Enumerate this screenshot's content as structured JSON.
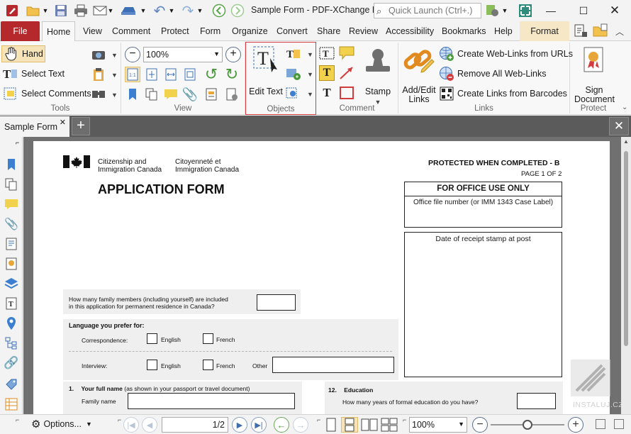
{
  "window": {
    "title": "Sample Form - PDF-XChange E...",
    "quick_launch_placeholder": "Quick Launch (Ctrl+.)"
  },
  "ribbon_tabs": [
    "File",
    "Home",
    "View",
    "Comment",
    "Protect",
    "Form",
    "Organize",
    "Convert",
    "Share",
    "Review",
    "Accessibility",
    "Bookmarks",
    "Help",
    "Format"
  ],
  "ribbon": {
    "tools": {
      "label": "Tools",
      "hand": "Hand",
      "select_text": "Select Text",
      "select_comments": "Select Comments"
    },
    "view": {
      "label": "View",
      "zoom": "100%"
    },
    "objects": {
      "label": "Objects",
      "edit_text": "Edit Text"
    },
    "comment": {
      "label": "Comment",
      "stamp": "Stamp"
    },
    "links": {
      "label": "Links",
      "add_edit": "Add/Edit Links",
      "create_web_links": "Create Web-Links from URLs",
      "remove_web_links": "Remove All Web-Links",
      "create_barcode_links": "Create Links from Barcodes"
    },
    "protect": {
      "label": "Protect",
      "sign_document": "Sign Document"
    }
  },
  "document_tab": {
    "name": "Sample Form"
  },
  "form": {
    "dept_en": [
      "Citizenship and",
      "Immigration Canada"
    ],
    "dept_fr": [
      "Citoyenneté et",
      "Immigration Canada"
    ],
    "protected": "PROTECTED WHEN COMPLETED - B",
    "page_of": "PAGE 1 OF 2",
    "title": "APPLICATION FORM",
    "office_use": "FOR OFFICE USE ONLY",
    "office_file": "Office file number (or IMM 1343 Case Label)",
    "receipt_stamp": "Date of receipt stamp at post",
    "family_q": [
      "How many family members (including yourself) are included",
      "in this application for permanent residence in Canada?"
    ],
    "language_heading": "Language you prefer for:",
    "correspondence": "Correspondence:",
    "interview": "Interview:",
    "english": "English",
    "french": "French",
    "other": "Other",
    "q1_num": "1.",
    "q1_bold": "Your full name",
    "q1_rest": "(as shown in your passport or travel document)",
    "family_name": "Family name",
    "q12_num": "12.",
    "q12_title": "Education",
    "q12_q": "How many years of formal education do you have?"
  },
  "statusbar": {
    "options": "Options...",
    "page_current": "1",
    "page_total": "2",
    "zoom": "100%",
    "zoom_slider_fraction": 0.5,
    "watermark": "INSTALUJ.CZ"
  },
  "colors": {
    "file_tab": "#b5282c",
    "format_tab": "#f6e8c7",
    "objects_highlight": "#d23c3c",
    "dark_bar": "#5b5b5b",
    "viewport_bg": "#707070"
  }
}
